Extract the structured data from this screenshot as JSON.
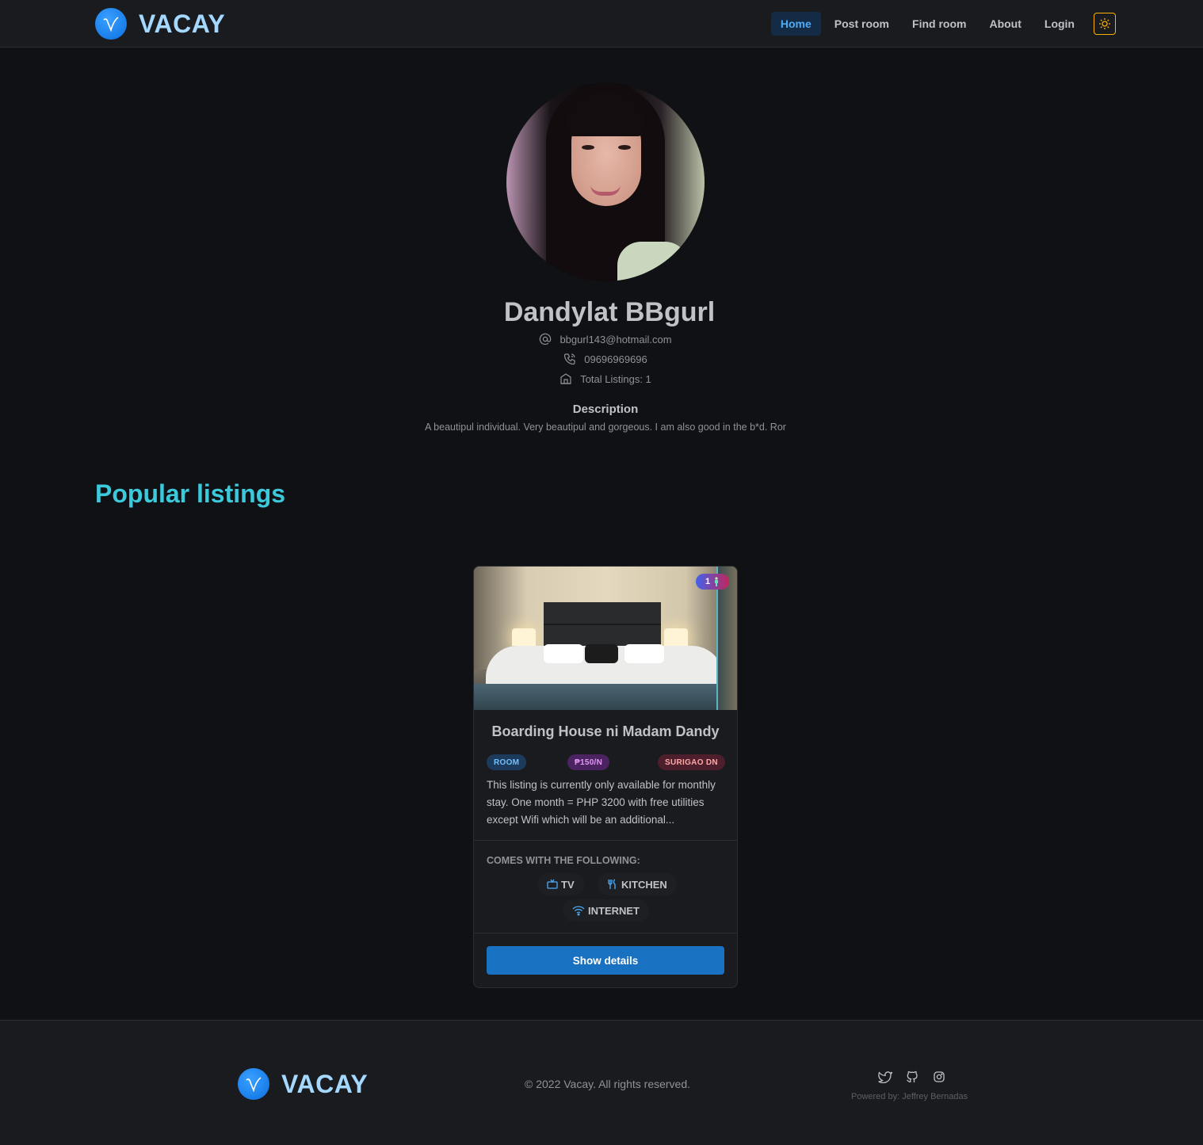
{
  "brand": {
    "name": "VACAY",
    "logo_icon": "v-logo-icon",
    "logo_color": "#1c7ed6"
  },
  "nav": {
    "items": [
      {
        "label": "Home",
        "active": true
      },
      {
        "label": "Post room",
        "active": false
      },
      {
        "label": "Find room",
        "active": false
      },
      {
        "label": "About",
        "active": false
      },
      {
        "label": "Login",
        "active": false
      }
    ],
    "theme_toggle_icon": "sun-icon"
  },
  "profile": {
    "name": "Dandylat BBgurl",
    "email": "bbgurl143@hotmail.com",
    "phone": "09696969696",
    "total_listings": "Total Listings: 1",
    "description_title": "Description",
    "description": "A beautipul individual. Very beautipul and gorgeous. I am also good in the b*d. Ror"
  },
  "section_title": "Popular listings",
  "listing": {
    "badge_count": "1",
    "title": "Boarding House ni Madam Dandy",
    "type": "ROOM",
    "price": "₱150/N",
    "location": "SURIGAO DN",
    "description": "This listing is currently only available for monthly stay. One month = PHP 3200 with free utilities except Wifi which will be an additional...",
    "features_title": "COMES WITH THE FOLLOWING:",
    "features": [
      {
        "label": "TV",
        "icon": "tv-icon"
      },
      {
        "label": "KITCHEN",
        "icon": "tools-kitchen-icon"
      },
      {
        "label": "INTERNET",
        "icon": "wifi-icon"
      }
    ],
    "button_label": "Show details"
  },
  "footer": {
    "brand": "VACAY",
    "copyright": "© 2022 Vacay. All rights reserved.",
    "powered_by": "Powered by: Jeffrey Bernadas",
    "socials": [
      "twitter-icon",
      "github-icon",
      "instagram-icon"
    ]
  },
  "colors": {
    "background": "#101114",
    "surface": "#1a1b1e",
    "accent": "#4dabf7",
    "section_title": "#3bc9db",
    "button": "#1971c2"
  }
}
